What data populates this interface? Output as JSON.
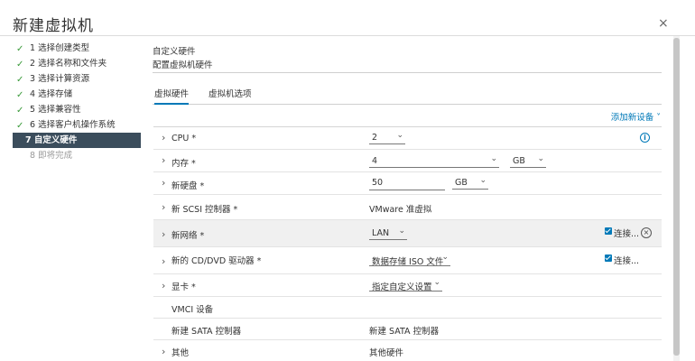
{
  "window": {
    "title": "新建虚拟机",
    "close_symbol": "×"
  },
  "steps": [
    {
      "label": "1 选择创建类型",
      "state": "done"
    },
    {
      "label": "2 选择名称和文件夹",
      "state": "done"
    },
    {
      "label": "3 选择计算资源",
      "state": "done"
    },
    {
      "label": "4 选择存储",
      "state": "done"
    },
    {
      "label": "5 选择兼容性",
      "state": "done"
    },
    {
      "label": "6 选择客户机操作系统",
      "state": "done"
    },
    {
      "label": "7 自定义硬件",
      "state": "active"
    },
    {
      "label": "8 即将完成",
      "state": "pending"
    }
  ],
  "section": {
    "title": "自定义硬件",
    "subtitle": "配置虚拟机硬件"
  },
  "tabs": {
    "virtual_hardware": "虚拟硬件",
    "vm_options": "虚拟机选项"
  },
  "add_device": "添加新设备 ˅",
  "hardware": {
    "cpu": {
      "label": "CPU *",
      "value": "2"
    },
    "memory": {
      "label": "内存 *",
      "value": "4",
      "unit": "GB"
    },
    "disk": {
      "label": "新硬盘 *",
      "value": "50",
      "unit": "GB"
    },
    "scsi": {
      "label": "新 SCSI 控制器 *",
      "value": "VMware 准虚拟"
    },
    "network": {
      "label": "新网络 *",
      "value": "LAN",
      "connect_label": "连接...",
      "connected": true
    },
    "cdrom": {
      "label": "新的 CD/DVD 驱动器 *",
      "value": "数据存储 ISO 文件",
      "connect_label": "连接...",
      "connected": true
    },
    "video": {
      "label": "显卡 *",
      "value": "指定自定义设置"
    },
    "vmci": {
      "label": "VMCI 设备"
    },
    "sata": {
      "label": "新建 SATA 控制器",
      "value": "新建 SATA 控制器"
    },
    "other": {
      "label": "其他",
      "value": "其他硬件"
    }
  },
  "symbols": {
    "chevron_right": "›",
    "chevron_down": "⌄",
    "check": "✓",
    "info": "i",
    "remove": "×"
  },
  "colors": {
    "accent": "#0079b8",
    "active_step_bg": "#3b4d5c",
    "check_green": "#3a9a3a"
  }
}
